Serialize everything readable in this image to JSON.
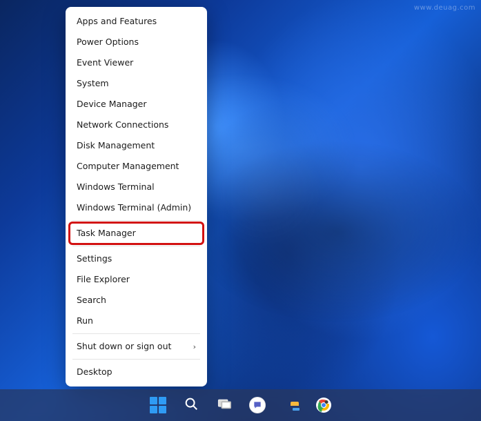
{
  "watermark": "www.deuag.com",
  "context_menu": {
    "items": [
      {
        "label": "Apps and Features",
        "submenu": false
      },
      {
        "label": "Power Options",
        "submenu": false
      },
      {
        "label": "Event Viewer",
        "submenu": false
      },
      {
        "label": "System",
        "submenu": false
      },
      {
        "label": "Device Manager",
        "submenu": false
      },
      {
        "label": "Network Connections",
        "submenu": false
      },
      {
        "label": "Disk Management",
        "submenu": false
      },
      {
        "label": "Computer Management",
        "submenu": false
      },
      {
        "label": "Windows Terminal",
        "submenu": false
      },
      {
        "label": "Windows Terminal (Admin)",
        "submenu": false
      },
      {
        "label": "Task Manager",
        "submenu": false,
        "highlighted": true
      },
      {
        "label": "Settings",
        "submenu": false
      },
      {
        "label": "File Explorer",
        "submenu": false
      },
      {
        "label": "Search",
        "submenu": false
      },
      {
        "label": "Run",
        "submenu": false
      },
      {
        "label": "Shut down or sign out",
        "submenu": true
      },
      {
        "label": "Desktop",
        "submenu": false
      }
    ],
    "separator_after_indices": [
      9,
      10,
      14,
      15
    ],
    "submenu_arrow": "›"
  },
  "taskbar": {
    "items": [
      {
        "name": "start-button",
        "icon": "start-icon"
      },
      {
        "name": "search-button",
        "icon": "search-icon"
      },
      {
        "name": "task-view-button",
        "icon": "task-view-icon"
      },
      {
        "name": "chat-button",
        "icon": "chat-icon"
      },
      {
        "name": "file-explorer-button",
        "icon": "folder-icon"
      },
      {
        "name": "chrome-button",
        "icon": "chrome-icon"
      }
    ]
  },
  "colors": {
    "highlight_outline": "#d21010",
    "menu_bg": "#ffffff",
    "menu_text": "#1b1b1b"
  }
}
